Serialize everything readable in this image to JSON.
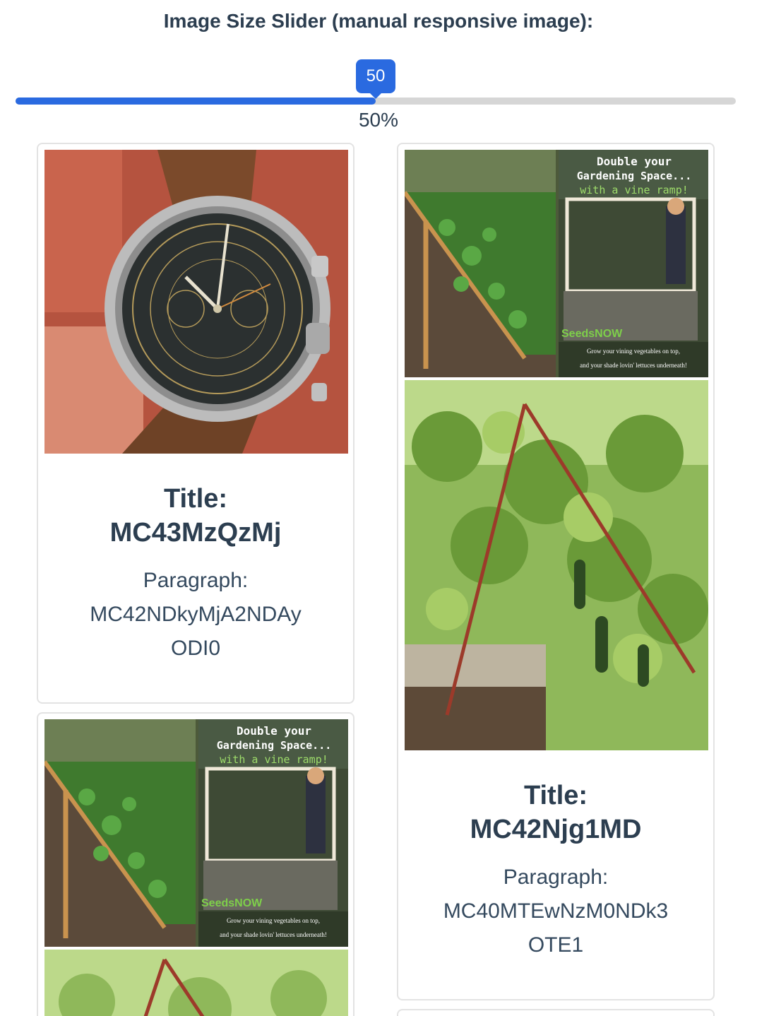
{
  "heading": "Image Size Slider (manual responsive image):",
  "slider": {
    "value": "50",
    "percent_label": "50%",
    "fraction": 0.5
  },
  "cards": [
    {
      "title_label": "Title:",
      "title_value": "MC43MzQzMj",
      "para_label": "Paragraph:",
      "para_line1": "MC42NDkyMjA2NDAy",
      "para_line2": "ODI0",
      "image": "vintage-chronograph-watch-photo"
    },
    {
      "title_label": "Title:",
      "title_value": "MC42Njg1MD",
      "para_label": "Paragraph:",
      "para_line1": "MC40MTEwNzM0NDk3",
      "para_line2": "OTE1",
      "image": "cucumber-vine-ramp-garden-photo"
    },
    {
      "image": "cucumber-vine-ramp-garden-photo"
    }
  ],
  "image_overlay": {
    "line1": "Double your",
    "line2": "Gardening Space...",
    "line3": "with a vine ramp!",
    "brand": "SeedsNOW",
    "caption1": "Grow your vining vegetables on top,",
    "caption2": "and your shade lovin' lettuces underneath!"
  },
  "colors": {
    "accent": "#2a6ae0",
    "text": "#2c3e50",
    "border": "#e3e3e3"
  }
}
